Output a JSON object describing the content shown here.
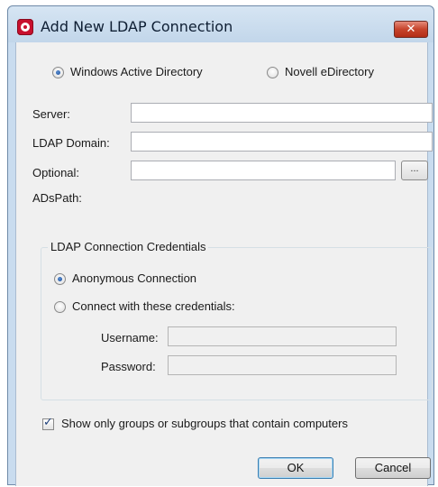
{
  "window": {
    "title": "Add New LDAP Connection",
    "close_glyph": "✕",
    "accent_color": "#c8102e",
    "icon": "ldap-app-icon"
  },
  "directory_type": {
    "options": [
      {
        "label": "Windows Active Directory",
        "selected": true
      },
      {
        "label": "Novell eDirectory",
        "selected": false
      }
    ]
  },
  "fields": {
    "server_label": "Server:",
    "server_value": "",
    "ldap_domain_label": "LDAP Domain:",
    "ldap_domain_value": "",
    "optional_label": "Optional:",
    "optional_value": "",
    "adspath_label": "ADsPath:",
    "browse_label": "..."
  },
  "credentials": {
    "group_title": "LDAP Connection Credentials",
    "anonymous_label": "Anonymous Connection",
    "anonymous_selected": true,
    "custom_label": "Connect with these credentials:",
    "custom_selected": false,
    "username_label": "Username:",
    "username_value": "",
    "password_label": "Password:",
    "password_value": ""
  },
  "filter": {
    "label": "Show only groups or subgroups that contain computers",
    "checked": true
  },
  "buttons": {
    "ok_label": "OK",
    "cancel_label": "Cancel"
  }
}
